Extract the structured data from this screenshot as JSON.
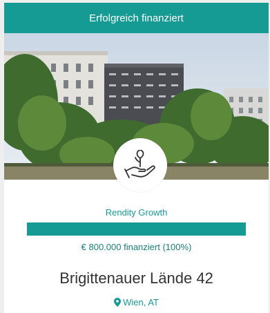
{
  "banner": {
    "text": "Erfolgreich finanziert"
  },
  "project": {
    "category": "Rendity Growth",
    "funded_text": "€ 800.000 finanziert (100%)",
    "funded_fraction": 1.0,
    "title": "Brigittenauer Lände 42",
    "location": "Wien, AT"
  },
  "icons": {
    "badge": "plant-in-hand-icon",
    "location": "map-pin-icon"
  },
  "colors": {
    "accent": "#169b94",
    "progress_track": "#d3eceb",
    "title_text": "#333333"
  }
}
